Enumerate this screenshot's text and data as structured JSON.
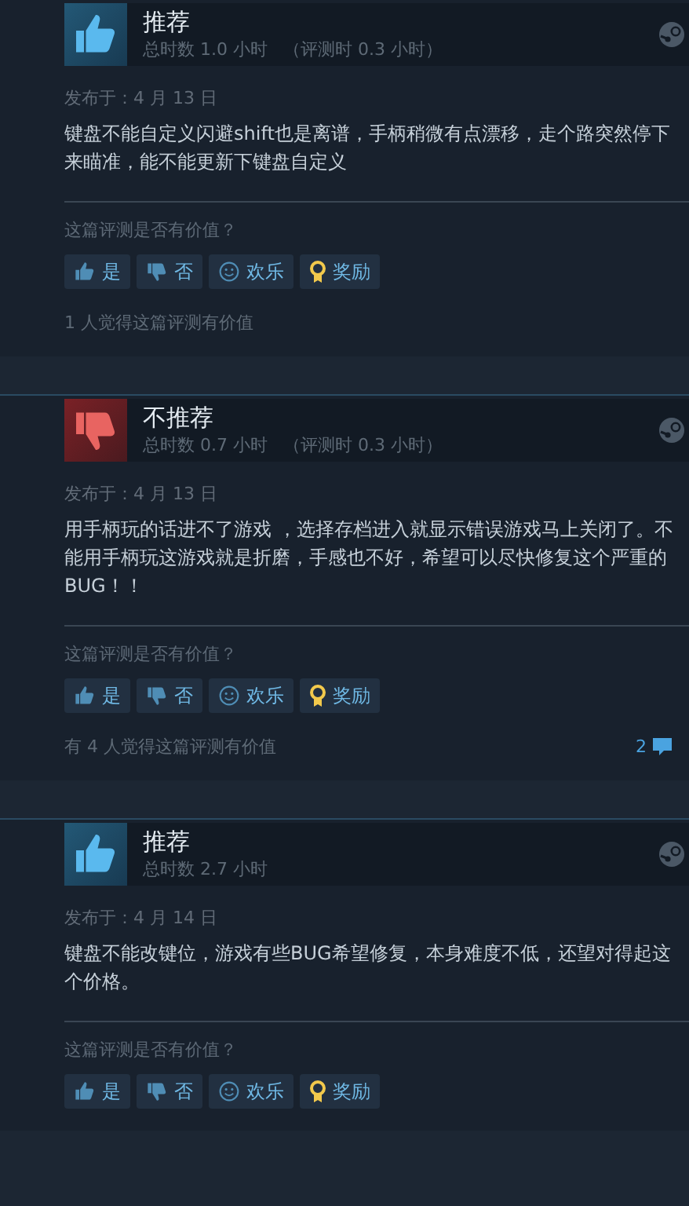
{
  "reviews": [
    {
      "kind": "recommended",
      "title": "推荐",
      "playtime": "总时数 1.0 小时",
      "review_time": "（评测时 0.3 小时）",
      "date": "发布于：4 月 13 日",
      "text": "键盘不能自定义闪避shift也是离谱，手柄稍微有点漂移，走个路突然停下来瞄准，能不能更新下键盘自定义",
      "question": "这篇评测是否有价值？",
      "buttons": [
        {
          "kind": "yes",
          "label": "是"
        },
        {
          "kind": "no",
          "label": "否"
        },
        {
          "kind": "funny",
          "label": "欢乐"
        },
        {
          "kind": "award",
          "label": "奖励"
        }
      ],
      "helpful": "1 人觉得这篇评测有价值"
    },
    {
      "kind": "not_recommended",
      "title": "不推荐",
      "playtime": "总时数 0.7 小时",
      "review_time": "（评测时 0.3 小时）",
      "date": "发布于：4 月 13 日",
      "text": "用手柄玩的话进不了游戏 ，选择存档进入就显示错误游戏马上关闭了。不能用手柄玩这游戏就是折磨，手感也不好，希望可以尽快修复这个严重的BUG！！",
      "question": "这篇评测是否有价值？",
      "buttons": [
        {
          "kind": "yes",
          "label": "是"
        },
        {
          "kind": "no",
          "label": "否"
        },
        {
          "kind": "funny",
          "label": "欢乐"
        },
        {
          "kind": "award",
          "label": "奖励"
        }
      ],
      "helpful": "有 4 人觉得这篇评测有价值",
      "comments": "2"
    },
    {
      "kind": "recommended",
      "title": "推荐",
      "playtime": "总时数 2.7 小时",
      "date": "发布于：4 月 14 日",
      "text": "键盘不能改键位，游戏有些BUG希望修复，本身难度不低，还望对得起这个价格。",
      "question": "这篇评测是否有价值？",
      "buttons": [
        {
          "kind": "yes",
          "label": "是"
        },
        {
          "kind": "no",
          "label": "否"
        },
        {
          "kind": "funny",
          "label": "欢乐"
        },
        {
          "kind": "award",
          "label": "奖励"
        }
      ]
    }
  ]
}
